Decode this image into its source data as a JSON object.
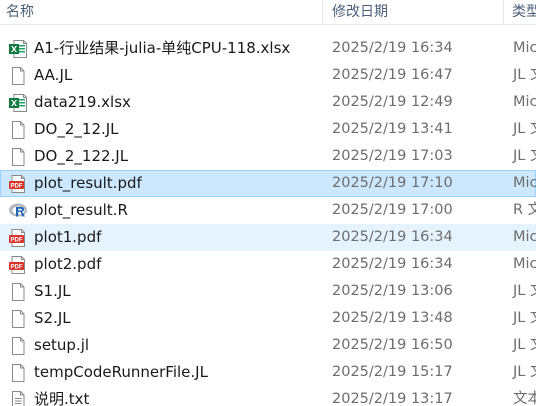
{
  "columns": {
    "name": "名称",
    "date": "修改日期",
    "type": "类型"
  },
  "files": [
    {
      "name": "A1-行业结果-julia-单纯CPU-118.xlsx",
      "date": "2025/2/19 16:34",
      "type": "Mic",
      "icon": "excel-icon"
    },
    {
      "name": "AA.JL",
      "date": "2025/2/19 16:47",
      "type": "JL 文",
      "icon": "file-icon"
    },
    {
      "name": "data219.xlsx",
      "date": "2025/2/19 12:49",
      "type": "Mic",
      "icon": "excel-icon"
    },
    {
      "name": "DO_2_12.JL",
      "date": "2025/2/19 13:41",
      "type": "JL 文",
      "icon": "file-icon"
    },
    {
      "name": "DO_2_122.JL",
      "date": "2025/2/19 17:03",
      "type": "JL 文",
      "icon": "file-icon"
    },
    {
      "name": "plot_result.pdf",
      "date": "2025/2/19 17:10",
      "type": "Mic",
      "icon": "pdf-icon"
    },
    {
      "name": "plot_result.R",
      "date": "2025/2/19 17:00",
      "type": "R 文",
      "icon": "r-script-icon"
    },
    {
      "name": "plot1.pdf",
      "date": "2025/2/19 16:34",
      "type": "Mic",
      "icon": "pdf-icon"
    },
    {
      "name": "plot2.pdf",
      "date": "2025/2/19 16:34",
      "type": "Mic",
      "icon": "pdf-icon"
    },
    {
      "name": "S1.JL",
      "date": "2025/2/19 13:06",
      "type": "JL 文",
      "icon": "file-icon"
    },
    {
      "name": "S2.JL",
      "date": "2025/2/19 13:48",
      "type": "JL 文",
      "icon": "file-icon"
    },
    {
      "name": "setup.jl",
      "date": "2025/2/19 16:50",
      "type": "JL 文",
      "icon": "file-icon"
    },
    {
      "name": "tempCodeRunnerFile.JL",
      "date": "2025/2/19 15:17",
      "type": "JL 文",
      "icon": "file-icon"
    },
    {
      "name": "说明.txt",
      "date": "2025/2/19 13:17",
      "type": "文本",
      "icon": "text-file-icon"
    }
  ],
  "selected_file": "plot_result.pdf",
  "hovered_file": "plot1.pdf",
  "colors": {
    "selection_bg": "#cce8ff",
    "selection_border": "#99d1ff",
    "hover_bg": "#e5f3ff",
    "header_text": "#4c607a",
    "secondary_text": "#6d6d6d"
  }
}
